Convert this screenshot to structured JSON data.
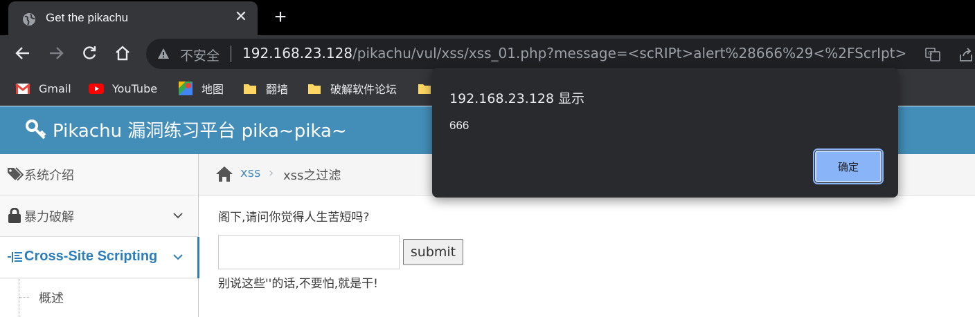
{
  "browser": {
    "tab_title": "Get the pikachu",
    "tab_close": "✕",
    "new_tab": "+",
    "security_label": "不安全",
    "url_host": "192.168.23.128",
    "url_path": "/pikachu/vul/xss/xss_01.php?message=<scRIPt>alert%28666%29<%2FScrIpt>...",
    "bookmarks": [
      {
        "label": "Gmail",
        "icon": "gmail-icon"
      },
      {
        "label": "YouTube",
        "icon": "youtube-icon"
      },
      {
        "label": "地图",
        "icon": "maps-icon"
      },
      {
        "label": "翻墙",
        "icon": "folder-icon"
      },
      {
        "label": "破解软件论坛",
        "icon": "folder-icon"
      }
    ]
  },
  "page": {
    "brand": "Pikachu 漏洞练习平台 pika~pika~",
    "sidebar": {
      "items": [
        {
          "label": "系统介绍",
          "icon": "tags-icon"
        },
        {
          "label": "暴力破解",
          "icon": "lock-icon"
        },
        {
          "label": "Cross-Site Scripting",
          "icon": "list-icon"
        }
      ],
      "sub_item": "概述"
    },
    "breadcrumb": {
      "link": "xss",
      "separator": "›",
      "current": "xss之过滤"
    },
    "question": "阁下,请问你觉得人生苦短吗?",
    "input_value": "",
    "submit_label": "submit",
    "result_text": "别说这些''的话,不要怕,就是干!"
  },
  "dialog": {
    "title": "192.168.23.128 显示",
    "message": "666",
    "ok_label": "确定"
  },
  "colors": {
    "navbar": "#438eb9",
    "link": "#4c8fbd",
    "dialog_bg": "#292a2d",
    "dialog_button": "#8ab4f8"
  }
}
